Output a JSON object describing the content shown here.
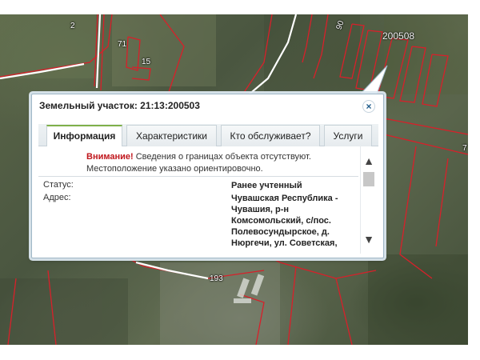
{
  "map": {
    "parcel_numbers": [
      "2",
      "71",
      "15",
      "90",
      "193",
      "7"
    ],
    "cadastral_label": "200508",
    "boundary_color": "#d8202a"
  },
  "popup": {
    "title": "Земельный участок: 21:13:200503",
    "close_icon": "×",
    "tabs": [
      "Информация",
      "Характеристики",
      "Кто обслуживает?",
      "Услуги"
    ],
    "active_tab": "Информация",
    "warning_label": "Внимание!",
    "warning_text": " Сведения о границах объекта отсутствуют. Местоположение указано ориентировочно.",
    "status_label": "Статус:",
    "status_value": "Ранее учтенный",
    "address_label": "Адрес:",
    "address_value": "Чувашская Республика - Чувашия, р-н Комсомольский, с/пос. Полевосундырское, д. Нюргечи, ул. Советская,",
    "scroll_up_icon": "▲",
    "scroll_down_icon": "▼"
  }
}
